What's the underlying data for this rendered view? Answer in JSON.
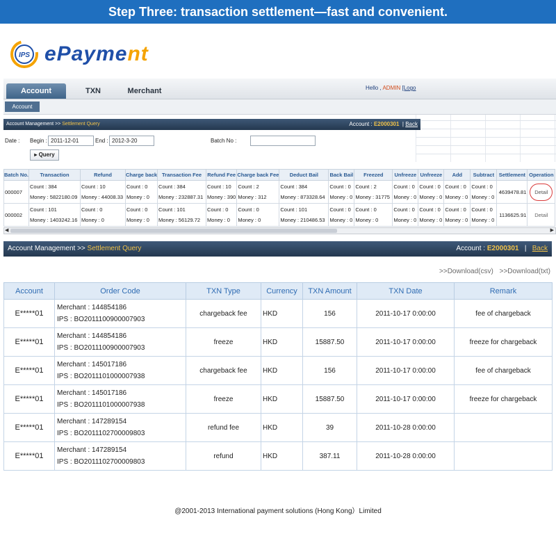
{
  "banner": {
    "title": "Step Three: transaction settlement—fast and convenient."
  },
  "logo": {
    "text_main": "ePayme",
    "text_accent": "nt",
    "mark": "IPS"
  },
  "screenshot": {
    "tabs": [
      "Account",
      "TXN",
      "Merchant"
    ],
    "hello": "Hello ,",
    "user": "ADMIN",
    "login_link": "[Logo",
    "subtab": "Account",
    "breadcrumb": {
      "first": "Account Management",
      "sep": ">>",
      "second": "Settlement Query"
    },
    "account_label": "Account :",
    "account_value": "E2000301",
    "back": "Back",
    "filter": {
      "date_label": "Date :",
      "begin_label": "Begin :",
      "begin_value": "2011-12-01",
      "end_label": "End :",
      "end_value": "2012-3-20",
      "batch_label": "Batch No :",
      "batch_value": "",
      "query_label": "Query"
    },
    "columns": [
      "Batch No.",
      "Transaction",
      "Refund",
      "Charge back",
      "Transaction Fee",
      "Refund Fee",
      "Charge back Fee",
      "Deduct Bail",
      "Back Bail",
      "Freezed",
      "Unfreeze",
      "Unfreeze",
      "Add",
      "Subtract",
      "Settlement",
      "Operation"
    ],
    "rows": [
      {
        "batch": "000007",
        "cells": [
          [
            "Count : 384",
            "Money : 5822180.09"
          ],
          [
            "Count : 10",
            "Money : 44008.33"
          ],
          [
            "Count : 0",
            "Money : 0"
          ],
          [
            "Count : 384",
            "Money : 232887.31"
          ],
          [
            "Count : 10",
            "Money : 390"
          ],
          [
            "Count : 2",
            "Money : 312"
          ],
          [
            "Count : 384",
            "Money : 873328.64"
          ],
          [
            "Count : 0",
            "Money : 0"
          ],
          [
            "Count : 2",
            "Money : 31775"
          ],
          [
            "Count : 0",
            "Money : 0"
          ],
          [
            "Count : 0",
            "Money : 0"
          ],
          [
            "Count : 0",
            "Money : 0"
          ],
          [
            "Count : 0",
            "Money : 0"
          ]
        ],
        "settlement": "4639478.81",
        "op": "Detail"
      },
      {
        "batch": "000002",
        "cells": [
          [
            "Count : 101",
            "Money : 1403242.16"
          ],
          [
            "Count : 0",
            "Money : 0"
          ],
          [
            "Count : 0",
            "Money : 0"
          ],
          [
            "Count : 101",
            "Money : 56129.72"
          ],
          [
            "Count : 0",
            "Money : 0"
          ],
          [
            "Count : 0",
            "Money : 0"
          ],
          [
            "Count : 101",
            "Money : 210486.53"
          ],
          [
            "Count : 0",
            "Money : 0"
          ],
          [
            "Count : 0",
            "Money : 0"
          ],
          [
            "Count : 0",
            "Money : 0"
          ],
          [
            "Count : 0",
            "Money : 0"
          ],
          [
            "Count : 0",
            "Money : 0"
          ],
          [
            "Count : 0",
            "Money : 0"
          ]
        ],
        "settlement": "1136625.91",
        "op": "Detail"
      }
    ]
  },
  "detail": {
    "breadcrumb": {
      "first": "Account Management",
      "sep": ">>",
      "second": "Settlement Query"
    },
    "account_label": "Account :",
    "account_value": "E2000301",
    "sep": "|",
    "back": "Back",
    "downloads": [
      ">>Download(csv)",
      ">>Download(txt)"
    ],
    "columns": [
      "Account",
      "Order Code",
      "TXN Type",
      "Currency",
      "TXN Amount",
      "TXN Date",
      "Remark"
    ],
    "rows": [
      {
        "account": "E*****01",
        "merchant": "Merchant : 144854186",
        "ips": "IPS : BO2011100900007903",
        "type": "chargeback fee",
        "currency": "HKD",
        "amount": "156",
        "date": "2011-10-17 0:00:00",
        "remark": "fee of chargeback"
      },
      {
        "account": "E*****01",
        "merchant": "Merchant : 144854186",
        "ips": "IPS : BO2011100900007903",
        "type": "freeze",
        "currency": "HKD",
        "amount": "15887.50",
        "date": "2011-10-17 0:00:00",
        "remark": "freeze for chargeback"
      },
      {
        "account": "E*****01",
        "merchant": "Merchant : 145017186",
        "ips": "IPS : BO2011101000007938",
        "type": "chargeback fee",
        "currency": "HKD",
        "amount": "156",
        "date": "2011-10-17 0:00:00",
        "remark": "fee of chargeback"
      },
      {
        "account": "E*****01",
        "merchant": "Merchant : 145017186",
        "ips": "IPS : BO2011101000007938",
        "type": "freeze",
        "currency": "HKD",
        "amount": "15887.50",
        "date": "2011-10-17 0:00:00",
        "remark": "freeze for chargeback"
      },
      {
        "account": "E*****01",
        "merchant": "Merchant : 147289154",
        "ips": "IPS : BO2011102700009803",
        "type": "refund fee",
        "currency": "HKD",
        "amount": "39",
        "date": "2011-10-28 0:00:00",
        "remark": ""
      },
      {
        "account": "E*****01",
        "merchant": "Merchant : 147289154",
        "ips": "IPS : BO2011102700009803",
        "type": "refund",
        "currency": "HKD",
        "amount": "387.11",
        "date": "2011-10-28 0:00:00",
        "remark": ""
      }
    ]
  },
  "footer": "@2001-2013 International payment solutions (Hong Kong）Limited",
  "colors": {
    "banner": "#1f6fbf",
    "header_bar": "#2f4560",
    "accent": "#f0c24a",
    "table_header": "#dfeaf6"
  }
}
